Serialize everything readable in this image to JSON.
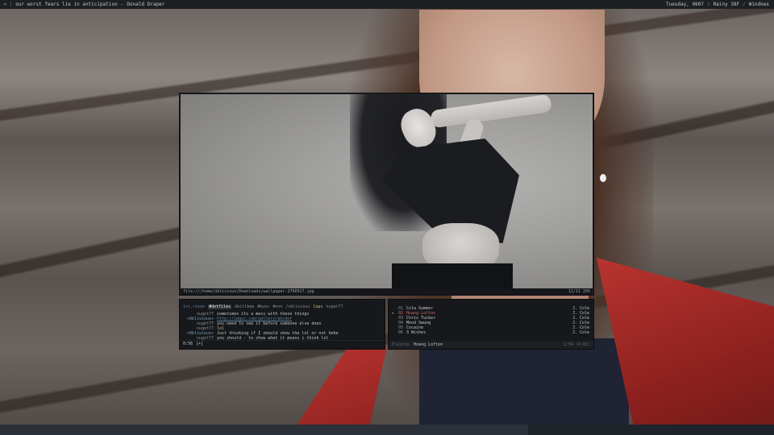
{
  "topbar": {
    "left_icon": "arrow-icon",
    "song": "our worst fears lie in anticipation",
    "separator": "–",
    "author": "Donald Draper",
    "right": [
      "Tuesday, 0607",
      "Rainy 38F",
      "Windows"
    ],
    "right_separator": "/"
  },
  "viewer": {
    "path": "file:///home/oblivious/Downloads/wallpaper-2766917.jpg",
    "position": "11/11 29%"
  },
  "irc": {
    "channels": [
      "irc.rizon",
      "#dotfiles",
      "&bitlbee",
      "#bunc",
      "#nnn",
      "/oblivious",
      "Caps",
      "nuget77"
    ],
    "lines": [
      {
        "nick": "nuget77",
        "msg": "sometimes its a mess with these things",
        "link": false,
        "me": false
      },
      {
        "nick": "<Oblivious>",
        "msg": "http://imgur.com/gallery/abcdef",
        "link": true,
        "me": true
      },
      {
        "nick": "nuget77",
        "msg": "you need to see it before someone else does",
        "link": false,
        "me": false
      },
      {
        "nick": "nuget77",
        "msg": "lol",
        "link": false,
        "me": false
      },
      {
        "nick": "<Oblivious>",
        "msg": "Just thinking if I should show the lol or not hehe",
        "link": false,
        "me": true
      },
      {
        "nick": "nuget77",
        "msg": "you should - to show what it means i think lol",
        "link": false,
        "me": false
      }
    ],
    "input_time": "0:56",
    "input_prompt": "[+]"
  },
  "music": {
    "tracks": [
      {
        "num": "01",
        "title": "Cola Summer",
        "artist": "J. Cole",
        "playing": false
      },
      {
        "num": "02",
        "title": "Hoang Lofton",
        "artist": "J. Cole",
        "playing": true
      },
      {
        "num": "03",
        "title": "Chris Tucker",
        "artist": "J. Cole",
        "playing": false
      },
      {
        "num": "04",
        "title": "Mood Swung",
        "artist": "J. Cole",
        "playing": false
      },
      {
        "num": "05",
        "title": "Cocaine",
        "artist": "J. Cole",
        "playing": false
      },
      {
        "num": "06",
        "title": "3 Wishes",
        "artist": "J. Cole",
        "playing": false
      }
    ],
    "footer_state": "Playing",
    "footer_now": "Hoang Lofton",
    "footer_time": "1:54 (4:02)"
  }
}
